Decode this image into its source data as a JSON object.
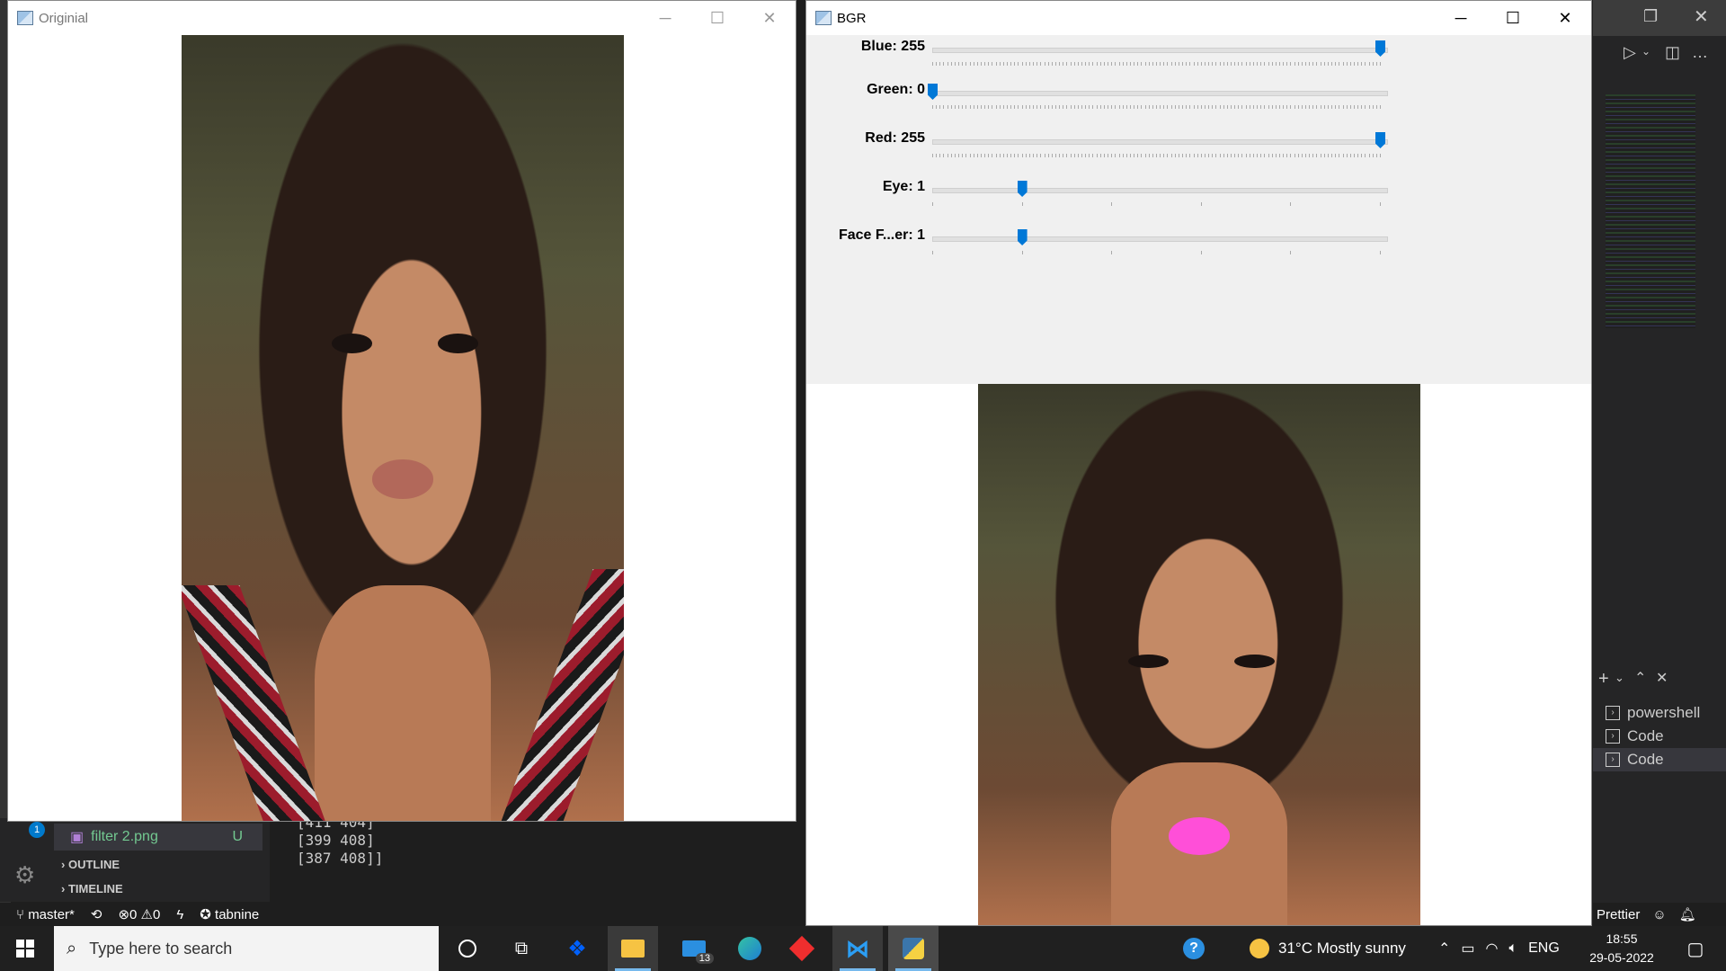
{
  "colors": {
    "accent": "#0078d7",
    "vscode_bg": "#1e1e1e",
    "taskbar": "#202020",
    "lip_filter": "#ff4fd8"
  },
  "window_original": {
    "title": "Originial"
  },
  "window_bgr": {
    "title": "BGR",
    "trackbars": [
      {
        "label": "Blue: 255",
        "value": 255,
        "max": 255
      },
      {
        "label": "Green: 0",
        "value": 0,
        "max": 255
      },
      {
        "label": "Red: 255",
        "value": 255,
        "max": 255
      },
      {
        "label": "Eye: 1",
        "value": 1,
        "max": 5
      },
      {
        "label": "Face F...er: 1",
        "value": 1,
        "max": 5
      }
    ]
  },
  "vscode": {
    "explorer_file": "filter 2.png",
    "explorer_file_status": "U",
    "explorer_badge": "1",
    "sections": [
      "OUTLINE",
      "TIMELINE"
    ],
    "terminal_output": "[411 404]\n[399 408]\n[387 408]]",
    "terminal_list": [
      "powershell",
      "Code",
      "Code"
    ],
    "status": {
      "branch": "master*",
      "errors": "0",
      "warnings": "0",
      "tabnine": "tabnine",
      "prettier": "Prettier"
    }
  },
  "taskbar": {
    "search_placeholder": "Type here to search",
    "mail_badge": "13",
    "weather": "31°C  Mostly sunny",
    "language": "ENG",
    "time": "18:55",
    "date": "29-05-2022"
  }
}
